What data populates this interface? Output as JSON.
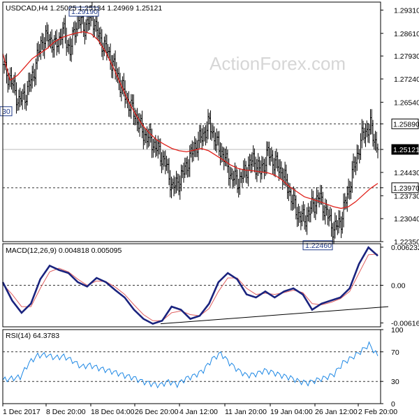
{
  "chart_data": [
    {
      "type": "candlestick",
      "title": "USDCAD,H4  1.25025 1.25134 1.24969 1.25121",
      "watermark": "ActionForex.com",
      "ylim": [
        1.2235,
        1.2955
      ],
      "y_ticks": [
        "1.29310",
        "1.28610",
        "1.27930",
        "1.27240",
        "1.26540",
        "1.25890",
        "1.25121",
        "1.24430",
        "1.23970",
        "1.23730",
        "1.23040",
        "1.22350"
      ],
      "y_tick_values": [
        1.2931,
        1.2861,
        1.2793,
        1.2724,
        1.2654,
        1.2589,
        1.25121,
        1.2443,
        1.2397,
        1.2373,
        1.2304,
        1.2235
      ],
      "x_ticks": [
        "1 Dec 2017",
        "8 Dec 20:00",
        "18 Dec 04:00",
        "26 Dec 20:00",
        "4 Jan 12:00",
        "11 Jan 20:00",
        "19 Jan 04:00",
        "26 Jan 12:00",
        "2 Feb 20:00"
      ],
      "levels": [
        {
          "value": 1.2589,
          "label": "1.25890",
          "style": "dashed",
          "boxed": true
        },
        {
          "value": 1.2397,
          "label": "1.23970",
          "style": "dashed",
          "boxed": true
        },
        {
          "value": 1.25121,
          "label": "1.25121",
          "style": "solid-gray",
          "boxed": true,
          "dark": true
        }
      ],
      "annotations": [
        {
          "label": "1.29190",
          "value": 1.2919
        },
        {
          "label": "1.22460",
          "value": 1.2246
        },
        {
          "label": "30",
          "value": 1.2628
        }
      ],
      "path_points": [
        1.2755,
        1.2715,
        1.2655,
        1.268,
        1.274,
        1.283,
        1.285,
        1.282,
        1.287,
        1.281,
        1.2905,
        1.288,
        1.2915,
        1.2845,
        1.281,
        1.276,
        1.27,
        1.265,
        1.261,
        1.256,
        1.254,
        1.251,
        1.247,
        1.2395,
        1.242,
        1.247,
        1.252,
        1.255,
        1.259,
        1.253,
        1.249,
        1.243,
        1.2415,
        1.245,
        1.248,
        1.2445,
        1.25,
        1.247,
        1.244,
        1.238,
        1.232,
        1.23,
        1.234,
        1.237,
        1.232,
        1.227,
        1.23,
        1.239,
        1.248,
        1.256,
        1.258,
        1.25121
      ],
      "ma_points": [
        1.28,
        1.272,
        1.2735,
        1.276,
        1.2785,
        1.28,
        1.2815,
        1.2835,
        1.2848,
        1.2856,
        1.2862,
        1.2866,
        1.286,
        1.284,
        1.2805,
        1.276,
        1.271,
        1.266,
        1.262,
        1.2585,
        1.256,
        1.254,
        1.2527,
        1.2515,
        1.2508,
        1.2505,
        1.251,
        1.2515,
        1.2508,
        1.2494,
        1.248,
        1.2465,
        1.2455,
        1.245,
        1.2448,
        1.2445,
        1.2442,
        1.2435,
        1.242,
        1.24,
        1.2385,
        1.237,
        1.2363,
        1.2356,
        1.2348,
        1.234,
        1.2335,
        1.234,
        1.2355,
        1.2375,
        1.2395,
        1.241
      ]
    },
    {
      "type": "line",
      "title": "MACD(12,26,9) 0.004818 0.005095",
      "ylim": [
        -0.0068,
        0.0068
      ],
      "y_ticks": [
        "0.006232",
        "0.00",
        "-0.006163"
      ],
      "y_tick_values": [
        0.006232,
        0,
        -0.006163
      ],
      "macd_points": [
        0.0005,
        -0.0025,
        -0.0045,
        -0.003,
        0.001,
        0.0032,
        0.0025,
        0.002,
        0.0005,
        -0.0002,
        0.0012,
        0.0005,
        -0.0008,
        -0.002,
        -0.004,
        -0.0055,
        -0.0063,
        -0.0058,
        -0.0035,
        -0.004,
        -0.0055,
        -0.005,
        -0.003,
        0.0005,
        0.002,
        0.001,
        -0.0015,
        -0.002,
        -0.001,
        -0.002,
        -0.001,
        -0.0005,
        -0.0015,
        -0.004,
        -0.003,
        -0.0025,
        -0.002,
        -0.0005,
        0.0035,
        0.0062,
        0.004818
      ],
      "signal_points": [
        0.0002,
        -0.0015,
        -0.0035,
        -0.0035,
        -0.0005,
        0.0022,
        0.0028,
        0.0022,
        0.001,
        0.0,
        0.0007,
        0.0006,
        -0.0003,
        -0.0015,
        -0.0032,
        -0.0048,
        -0.0058,
        -0.0058,
        -0.0045,
        -0.0042,
        -0.0048,
        -0.005,
        -0.0038,
        -0.001,
        0.0012,
        0.0012,
        -0.0005,
        -0.0015,
        -0.0013,
        -0.0015,
        -0.0012,
        -0.0008,
        -0.0012,
        -0.003,
        -0.0032,
        -0.0028,
        -0.0022,
        -0.001,
        0.002,
        0.005,
        0.005095
      ],
      "trendline": [
        -0.0063,
        -0.0035
      ]
    },
    {
      "type": "line",
      "title": "RSI(14) 64.3783",
      "ylim": [
        0,
        100
      ],
      "y_ticks": [
        "100",
        "70",
        "30",
        "0"
      ],
      "y_tick_values": [
        100,
        70,
        30,
        0
      ],
      "levels": [
        70,
        30
      ],
      "rsi_points": [
        32,
        34,
        36,
        55,
        65,
        66,
        62,
        64,
        58,
        50,
        52,
        48,
        45,
        42,
        38,
        35,
        30,
        27,
        25,
        30,
        26,
        34,
        38,
        45,
        60,
        68,
        55,
        45,
        38,
        40,
        45,
        42,
        38,
        35,
        30,
        28,
        32,
        35,
        40,
        55,
        62,
        70,
        80,
        64.3783
      ]
    }
  ]
}
